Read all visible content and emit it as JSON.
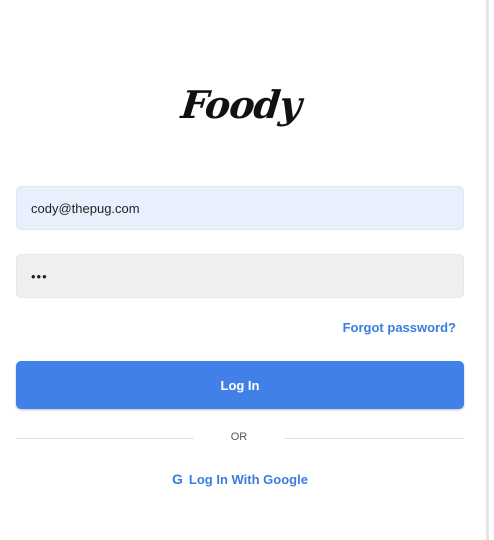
{
  "brand": {
    "logo_text": "Foody"
  },
  "login_form": {
    "email_value": "cody@thepug.com",
    "password_value": "•••",
    "forgot_password_label": "Forgot password?",
    "login_button_label": "Log In",
    "divider_text": "OR",
    "google_icon": "G",
    "google_login_label": "Log In With Google"
  },
  "colors": {
    "accent": "#4180e6",
    "link": "#3a7de0",
    "email_field_bg": "#e8f0fe",
    "password_field_bg": "#efefef"
  }
}
